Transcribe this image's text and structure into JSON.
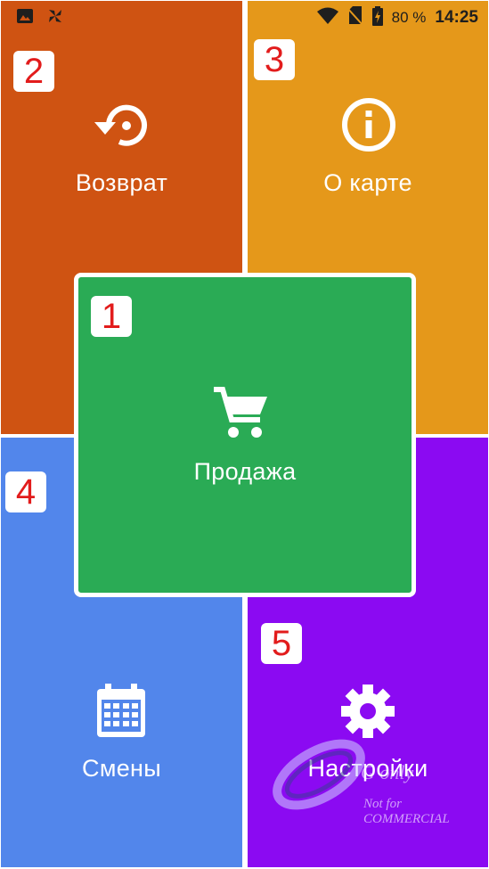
{
  "status_bar": {
    "battery_percent": "80 %",
    "time": "14:25",
    "icons": [
      "image-icon",
      "pinwheel-icon",
      "wifi-icon",
      "no-sim-icon",
      "battery-charging-icon"
    ]
  },
  "tiles": {
    "returns": {
      "number": "2",
      "label": "Возврат",
      "icon": "restore-icon",
      "color": "#cf5312"
    },
    "card_info": {
      "number": "3",
      "label": "О карте",
      "icon": "info-icon",
      "color": "#e5981a"
    },
    "sale": {
      "number": "1",
      "label": "Продажа",
      "icon": "cart-icon",
      "color": "#2aab55"
    },
    "shifts": {
      "number": "4",
      "label": "Смены",
      "icon": "calendar-icon",
      "color": "#5286eb"
    },
    "settings": {
      "number": "5",
      "label": "Настройки",
      "icon": "gear-icon",
      "color": "#8b0af2"
    }
  },
  "watermark": {
    "line1": "G only",
    "line2": "Not for COMMERCIAL"
  },
  "colors": {
    "badge_text": "#e21c1c",
    "status_text": "#1e1e1e"
  }
}
